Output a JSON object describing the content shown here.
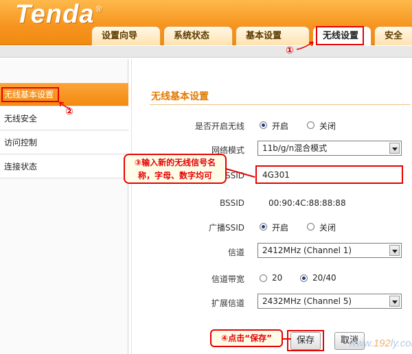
{
  "header": {
    "logo_text": "Tenda",
    "logo_mark": "®",
    "tabs": [
      {
        "label": "设置向导",
        "active": false
      },
      {
        "label": "系统状态",
        "active": false
      },
      {
        "label": "基本设置",
        "active": false
      },
      {
        "label": "无线设置",
        "active": true
      },
      {
        "label": "安全",
        "active": false
      }
    ]
  },
  "annotations": {
    "step1": "①",
    "step2": "②",
    "step3_line1": "③输入新的无线信号名",
    "step3_line2": "称，字母、数字均可",
    "step4": "④点击“保存”"
  },
  "sidebar": {
    "items": [
      {
        "label": "无线基本设置",
        "active": true
      },
      {
        "label": "无线安全",
        "active": false
      },
      {
        "label": "访问控制",
        "active": false
      },
      {
        "label": "连接状态",
        "active": false
      }
    ]
  },
  "form": {
    "section_title": "无线基本设置",
    "enable_wireless": {
      "label": "是否开启无线",
      "option_on": "开启",
      "option_off": "关闭",
      "value": "on"
    },
    "network_mode": {
      "label": "网络模式",
      "value": "11b/g/n混合模式"
    },
    "ssid": {
      "label": "SSID",
      "value": "4G301"
    },
    "bssid": {
      "label": "BSSID",
      "value": "00:90:4C:88:88:88"
    },
    "broadcast_ssid": {
      "label": "广播SSID",
      "option_on": "开启",
      "option_off": "关闭",
      "value": "on"
    },
    "channel": {
      "label": "信道",
      "value": "2412MHz (Channel 1)"
    },
    "bandwidth": {
      "label": "信道带宽",
      "option_a": "20",
      "option_b": "20/40",
      "value": "20/40"
    },
    "ext_channel": {
      "label": "扩展信道",
      "value": "2432MHz (Channel 5)"
    },
    "save_label": "保存",
    "cancel_label": "取消"
  },
  "watermark": {
    "prefix": "www.",
    "accent": "192",
    "suffix": "ly.com"
  },
  "colors": {
    "accent": "#f7931e",
    "highlight": "#e60000",
    "title": "#e07a00"
  }
}
